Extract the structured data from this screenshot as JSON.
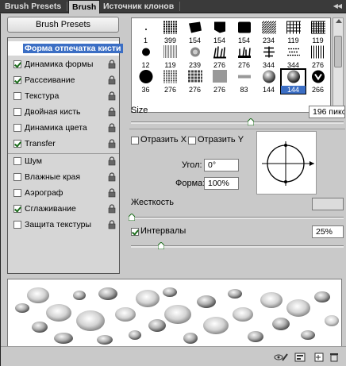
{
  "tabs": {
    "presets": "Brush Presets",
    "brush": "Brush",
    "clone": "Источник клонов"
  },
  "presets_button": "Brush Presets",
  "options": {
    "header": "Форма отпечатка кисти",
    "items": [
      {
        "label": "Динамика формы",
        "checked": true
      },
      {
        "label": "Рассеивание",
        "checked": true
      },
      {
        "label": "Текстура",
        "checked": false
      },
      {
        "label": "Двойная кисть",
        "checked": false
      },
      {
        "label": "Динамика цвета",
        "checked": false
      },
      {
        "label": "Transfer",
        "checked": true
      },
      {
        "label": "Шум",
        "checked": false
      },
      {
        "label": "Влажные края",
        "checked": false
      },
      {
        "label": "Аэрограф",
        "checked": false
      },
      {
        "label": "Сглаживание",
        "checked": true
      },
      {
        "label": "Защита текстуры",
        "checked": false
      }
    ]
  },
  "brush_grid": {
    "rows": [
      [
        "1",
        "399",
        "154",
        "154",
        "154",
        "234",
        "119",
        "119"
      ],
      [
        "12",
        "119",
        "239",
        "276",
        "276",
        "344",
        "344",
        "276"
      ],
      [
        "36",
        "276",
        "276",
        "276",
        "83",
        "144",
        "144",
        "266"
      ]
    ],
    "selected_row": 2,
    "selected_col": 6
  },
  "size": {
    "label": "Size",
    "value": "196 пикс",
    "level": 0.57
  },
  "flip": {
    "x_label": "Отразить X",
    "y_label": "Отразить Y",
    "x_checked": false,
    "y_checked": false
  },
  "angle": {
    "label": "Угол:",
    "value": "0°"
  },
  "roundness": {
    "label": "Форма:",
    "value": "100%"
  },
  "hardness": {
    "label": "Жесткость",
    "level": 0.0
  },
  "spacing": {
    "label": "Интервалы",
    "checked": true,
    "value": "25%",
    "level": 0.14
  }
}
